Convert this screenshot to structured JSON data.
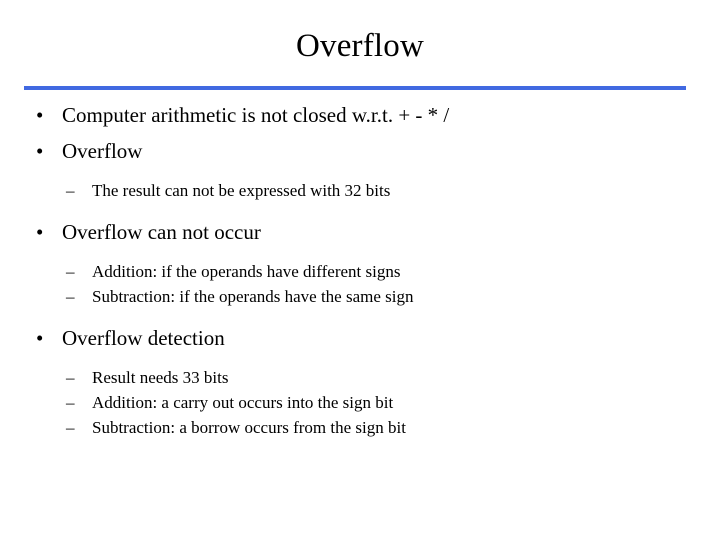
{
  "slide": {
    "title": "Overflow",
    "rule_color": "#4169e1",
    "background_color": "#ffffff",
    "text_color": "#000000",
    "bullet_marker": "•",
    "dash_marker": "–",
    "content": [
      {
        "level": 1,
        "marker": "•",
        "text": "Computer arithmetic is not closed w.r.t. +  -  *  /"
      },
      {
        "level": 1,
        "marker": "•",
        "text": "Overflow"
      },
      {
        "level": 2,
        "marker": "–",
        "text": "The result can not be expressed with 32 bits"
      },
      {
        "level": 1,
        "marker": "•",
        "text": "Overflow can not occur"
      },
      {
        "level": 2,
        "marker": "–",
        "text": "Addition: if the operands have different signs"
      },
      {
        "level": 2,
        "marker": "–",
        "text": "Subtraction: if the operands have the same sign"
      },
      {
        "level": 1,
        "marker": "•",
        "text": "Overflow detection"
      },
      {
        "level": 2,
        "marker": "–",
        "text": "Result needs 33 bits"
      },
      {
        "level": 2,
        "marker": "–",
        "text": "Addition: a carry out occurs into the sign bit"
      },
      {
        "level": 2,
        "marker": "–",
        "text": "Subtraction: a borrow occurs from the sign bit"
      }
    ]
  }
}
